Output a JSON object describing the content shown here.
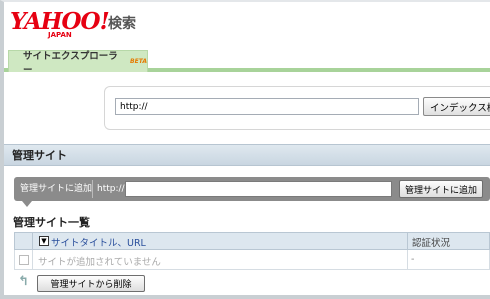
{
  "header": {
    "logo_text": "YAHOO!",
    "logo_sub": "JAPAN",
    "search_label": "検索",
    "tab_label": "サイトエクスプローラー",
    "tab_badge": "BETA",
    "brand_color": "#e60012"
  },
  "search": {
    "url_value": "http://",
    "index_button": "インデックス検索"
  },
  "managed": {
    "section_title": "管理サイト",
    "add_label": "管理サイトに追加",
    "http_prefix": "http://",
    "add_input_value": "",
    "add_button": "管理サイトに追加"
  },
  "site_list": {
    "title": "管理サイト一覧",
    "columns": [
      "サイトタイトル、URL",
      "認証状況"
    ],
    "sort_icon": "sort-down-icon",
    "rows": [
      {
        "title": "サイトが追加されていません",
        "status": "-"
      }
    ],
    "delete_button": "管理サイトから削除"
  }
}
